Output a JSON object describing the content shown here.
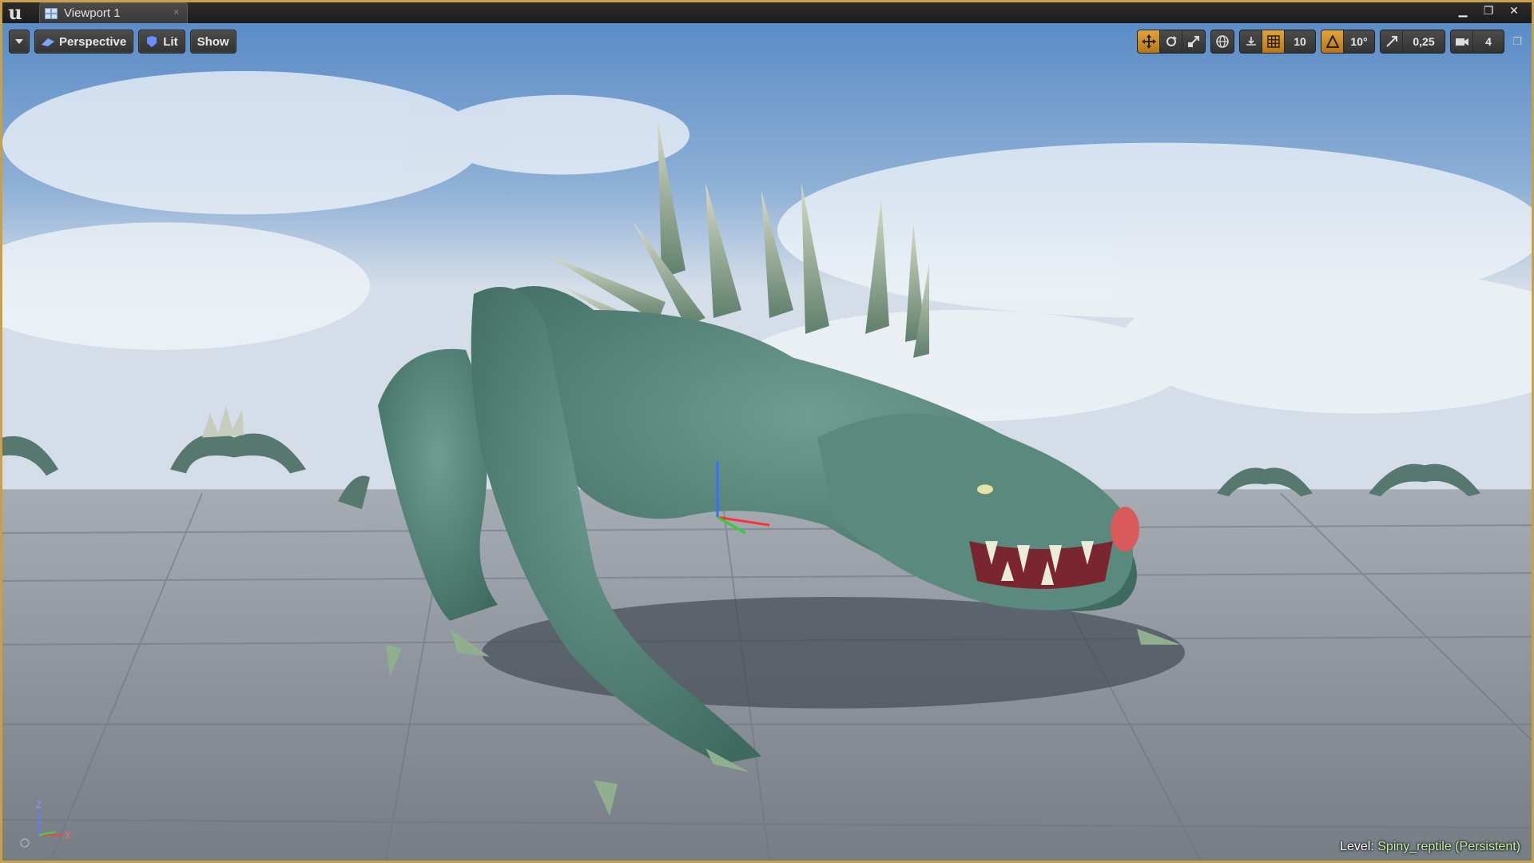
{
  "app": {
    "logo_text": "u",
    "tab_title": "Viewport 1",
    "window_controls": {
      "minimize": "▁",
      "restore": "❐",
      "close": "✕"
    }
  },
  "viewport_toolbar": {
    "menu_icon": "chevron-down-icon",
    "perspective_label": "Perspective",
    "lit_label": "Lit",
    "show_label": "Show",
    "grid_snap_value": "10",
    "rotation_snap_value": "10°",
    "scale_snap_value": "0,25",
    "camera_speed_value": "4",
    "active_color": "#e3a33b"
  },
  "status": {
    "level_label": "Level:",
    "level_name": "Spiny_reptile (Persistent)"
  },
  "colors": {
    "frame_border": "#c8a04a",
    "creature_skin": "#4e7f74",
    "floor": "#8e969f"
  }
}
